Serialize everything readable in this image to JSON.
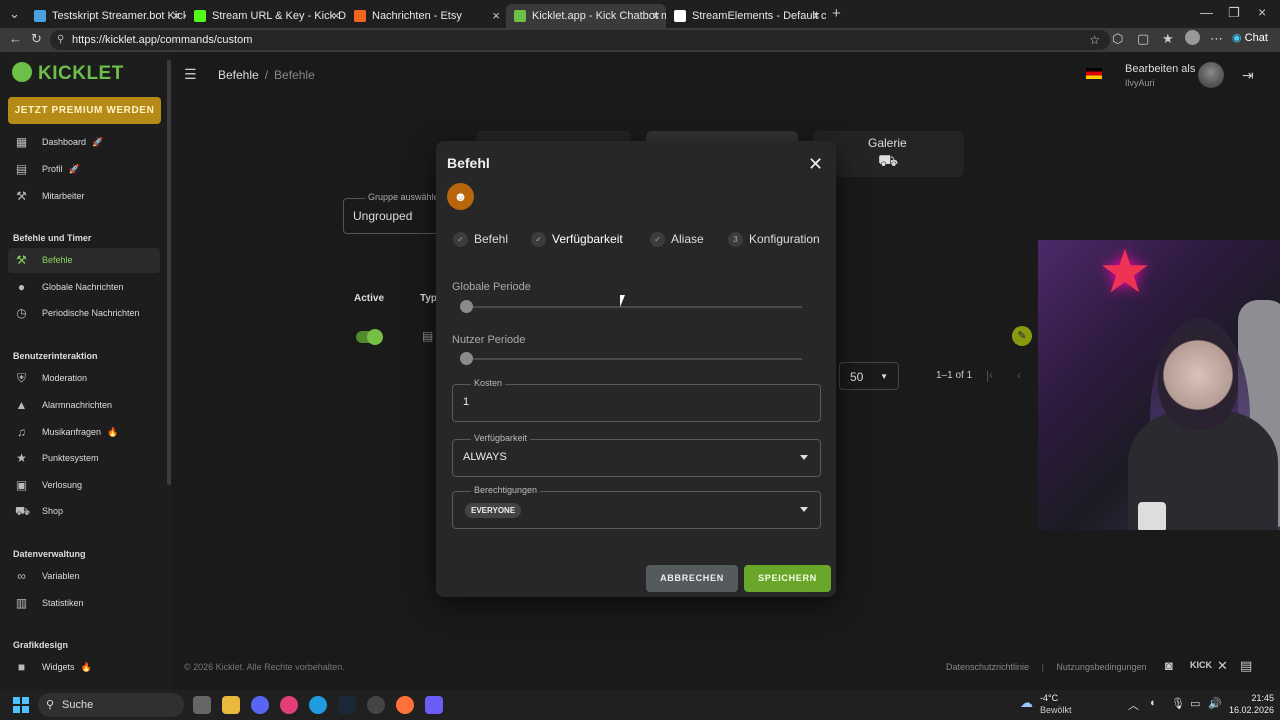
{
  "browser": {
    "tabs": [
      {
        "title": "Testskript Streamer.bot Kick",
        "color": "#4aa3df"
      },
      {
        "title": "Stream URL & Key - Kick Dashboa",
        "color": "#53fc18"
      },
      {
        "title": "Nachrichten - Etsy",
        "color": "#f1641e"
      },
      {
        "title": "Kicklet.app - Kick Chatbot mit",
        "color": "#6cc04a"
      },
      {
        "title": "StreamElements - Default comma",
        "color": "#ffffff"
      }
    ],
    "url": "https://kicklet.app/commands/custom",
    "chat_label": "Chat"
  },
  "sidebar": {
    "logo": "KICKLET",
    "premium_button": "JETZT PREMIUM WERDEN",
    "top_items": [
      {
        "label": "Dashboard",
        "icon": "dashboard-icon",
        "badge": "🚀"
      },
      {
        "label": "Profil",
        "icon": "profile-icon",
        "badge": "🚀"
      },
      {
        "label": "Mitarbeiter",
        "icon": "staff-icon",
        "badge": ""
      }
    ],
    "section_commands": "Befehle und Timer",
    "command_items": [
      {
        "label": "Befehle",
        "icon": "command-icon"
      },
      {
        "label": "Globale Nachrichten",
        "icon": "chat-bubble-icon"
      },
      {
        "label": "Periodische Nachrichten",
        "icon": "clock-icon"
      }
    ],
    "section_interaction": "Benutzerinteraktion",
    "interaction_items": [
      {
        "label": "Moderation",
        "icon": "shield-icon",
        "badge": ""
      },
      {
        "label": "Alarmnachrichten",
        "icon": "alert-icon",
        "badge": ""
      },
      {
        "label": "Musikanfragen",
        "icon": "music-icon",
        "badge": "🔥"
      },
      {
        "label": "Punktesystem",
        "icon": "star-icon",
        "badge": ""
      },
      {
        "label": "Verlosung",
        "icon": "gift-icon",
        "badge": ""
      },
      {
        "label": "Shop",
        "icon": "cart-icon",
        "badge": ""
      }
    ],
    "section_data": "Datenverwaltung",
    "data_items": [
      {
        "label": "Variablen",
        "icon": "link-icon"
      },
      {
        "label": "Statistiken",
        "icon": "stats-icon"
      }
    ],
    "section_design": "Grafikdesign",
    "design_items": [
      {
        "label": "Widgets",
        "icon": "video-icon",
        "badge": "🔥"
      }
    ]
  },
  "header": {
    "breadcrumb_root": "Befehle",
    "breadcrumb_current": "Befehle",
    "edit_as": "Bearbeiten als",
    "username": "IlvyAuri"
  },
  "page": {
    "gallery_label": "Galerie",
    "group_label": "Gruppe auswähle",
    "group_value": "Ungrouped",
    "col_active": "Active",
    "col_type": "Typ",
    "per_page": "50",
    "pager_text": "1–1 of 1",
    "footer_copy": "© 2026 Kicklet. Alle Rechte vorbehalten.",
    "footer_privacy": "Datenschutzrichtlinie",
    "footer_terms": "Nutzungsbedingungen"
  },
  "modal": {
    "title": "Befehl",
    "steps": [
      {
        "label": "Befehl",
        "marker": "✓"
      },
      {
        "label": "Verfügbarkeit",
        "marker": "✓"
      },
      {
        "label": "Aliase",
        "marker": "✓"
      },
      {
        "label": "Konfiguration",
        "marker": "3"
      }
    ],
    "global_period_label": "Globale Periode",
    "global_period_value": 0,
    "user_period_label": "Nutzer Periode",
    "user_period_value": 0,
    "cost_label": "Kosten",
    "cost_value": "1",
    "availability_label": "Verfügbarkeit",
    "availability_value": "ALWAYS",
    "permissions_label": "Berechtigungen",
    "permissions_chip": "EVERYONE",
    "cancel_label": "ABBRECHEN",
    "save_label": "SPEICHERN"
  },
  "taskbar": {
    "search_label": "Suche",
    "weather_temp": "-4°C",
    "weather_desc": "Bewölkt",
    "time": "21:45",
    "date": "16.02.2026"
  },
  "colors": {
    "accent_green": "#6cc04a",
    "premium_gold": "#b68a17",
    "save_green": "#6aa62a"
  }
}
